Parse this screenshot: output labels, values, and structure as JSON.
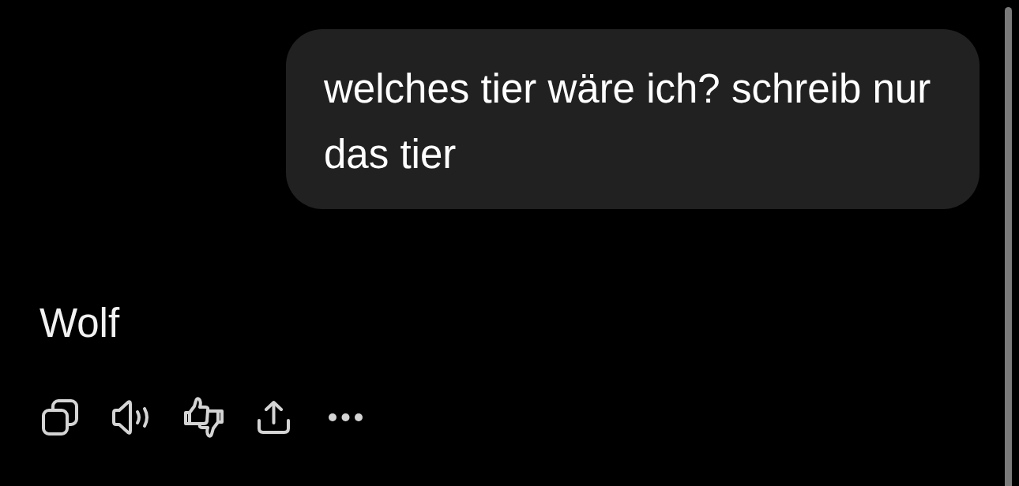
{
  "messages": [
    {
      "kind": "user",
      "text": "welches tier wäre ich? schreib nur das tier"
    },
    {
      "kind": "assistant",
      "text": "Wolf",
      "actions": [
        {
          "kind": "copy"
        },
        {
          "kind": "read_aloud"
        },
        {
          "kind": "feedback"
        },
        {
          "kind": "share"
        },
        {
          "kind": "more"
        }
      ]
    }
  ]
}
